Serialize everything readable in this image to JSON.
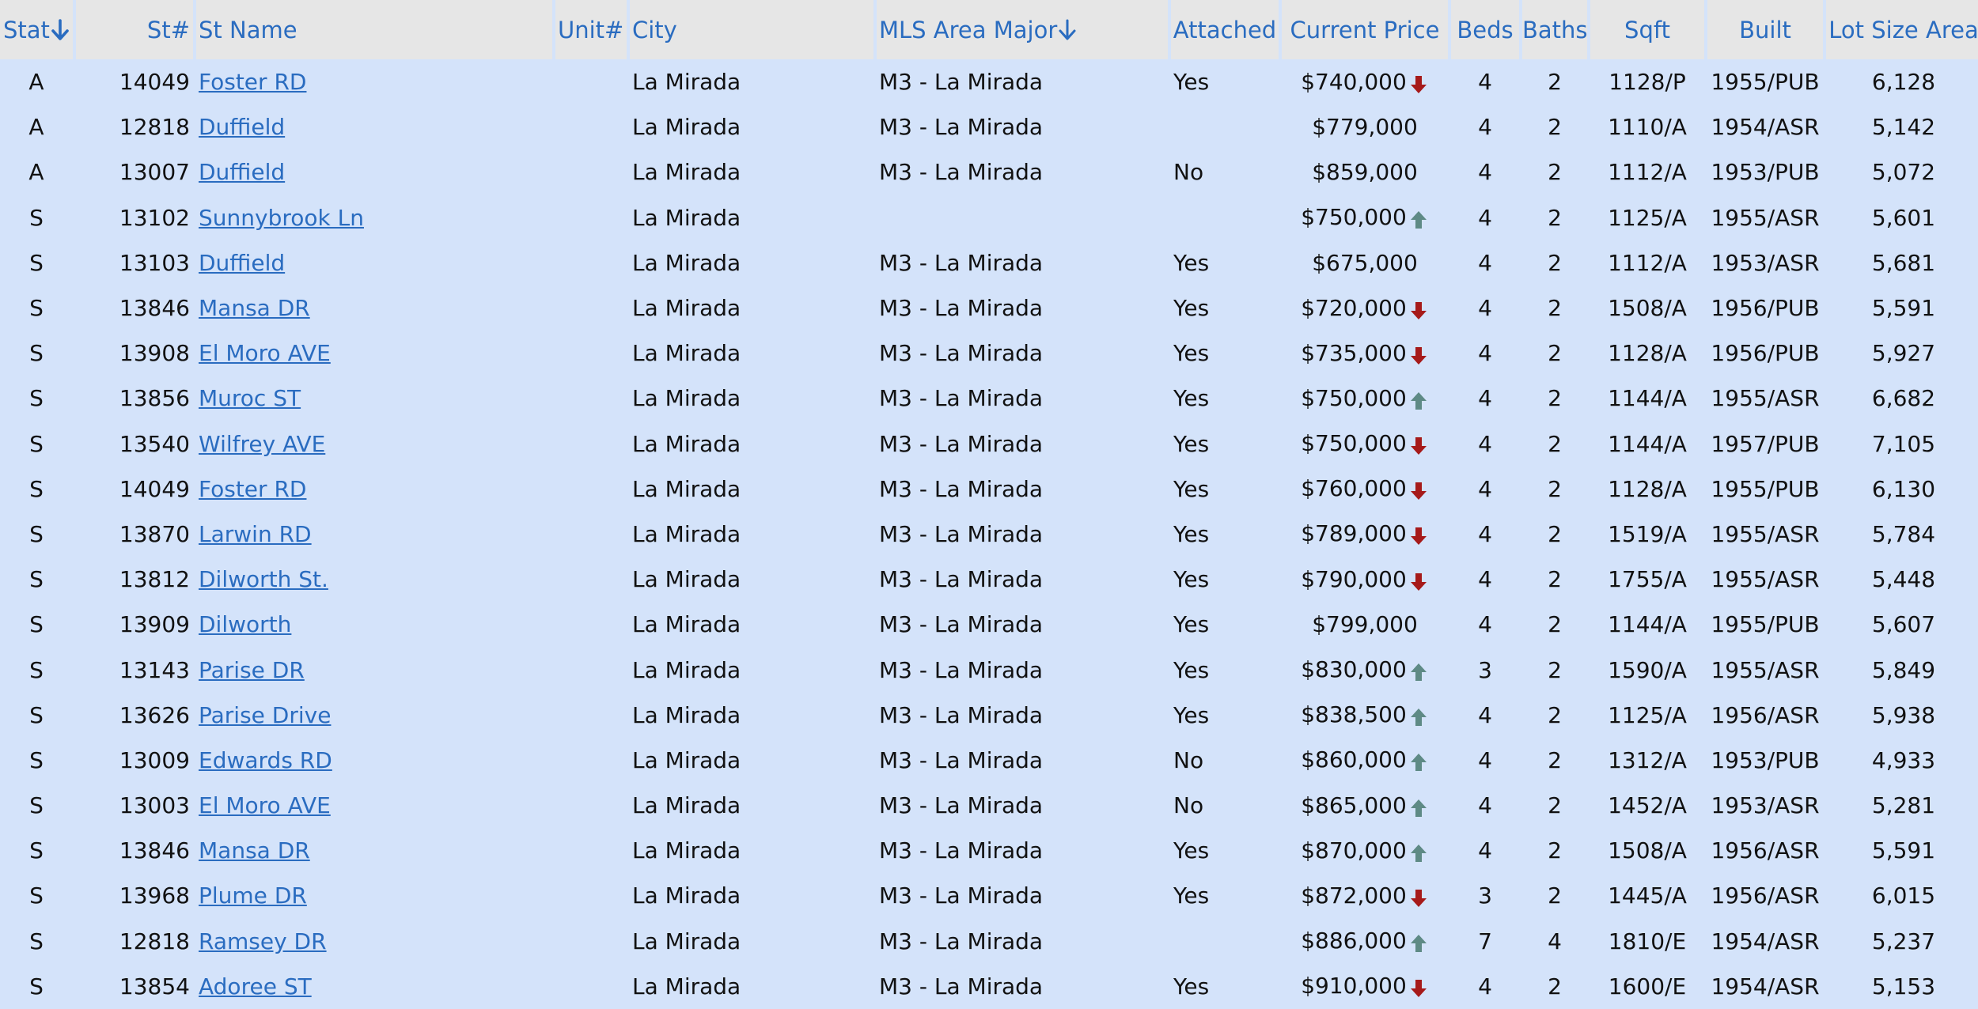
{
  "colors": {
    "header_bg": "#e6e6e6",
    "header_text": "#2a6cc0",
    "row_bg": "#d4e3fa",
    "link": "#2a6cc0",
    "trend_down": "#a61a1a",
    "trend_up": "#5e8a85"
  },
  "headers": {
    "stat": "Stat",
    "st_num": "St#",
    "st_name": "St Name",
    "unit": "Unit#",
    "city": "City",
    "mls_area": "MLS Area Major",
    "attached": "Attached",
    "current_price": "Current Price",
    "beds": "Beds",
    "baths": "Baths",
    "sqft": "Sqft",
    "built": "Built",
    "lot": "Lot Size Area"
  },
  "sort_icons": {
    "stat": "sort-down-arrow-icon",
    "mls_area": "sort-down-arrow-icon"
  },
  "rows": [
    {
      "stat": "A",
      "num": "14049",
      "name": "Foster RD",
      "unit": "",
      "city": "La Mirada",
      "area": "M3 - La Mirada",
      "attached": "Yes",
      "price": "$740,000",
      "trend": "down",
      "beds": "4",
      "baths": "2",
      "sqft": "1128/P",
      "built": "1955/PUB",
      "lot": "6,128"
    },
    {
      "stat": "A",
      "num": "12818",
      "name": "Duffield",
      "unit": "",
      "city": "La Mirada",
      "area": "M3 - La Mirada",
      "attached": "",
      "price": "$779,000",
      "trend": "",
      "beds": "4",
      "baths": "2",
      "sqft": "1110/A",
      "built": "1954/ASR",
      "lot": "5,142"
    },
    {
      "stat": "A",
      "num": "13007",
      "name": "Duffield",
      "unit": "",
      "city": "La Mirada",
      "area": "M3 - La Mirada",
      "attached": "No",
      "price": "$859,000",
      "trend": "",
      "beds": "4",
      "baths": "2",
      "sqft": "1112/A",
      "built": "1953/PUB",
      "lot": "5,072"
    },
    {
      "stat": "S",
      "num": "13102",
      "name": "Sunnybrook Ln",
      "unit": "",
      "city": "La Mirada",
      "area": "",
      "attached": "",
      "price": "$750,000",
      "trend": "up",
      "beds": "4",
      "baths": "2",
      "sqft": "1125/A",
      "built": "1955/ASR",
      "lot": "5,601"
    },
    {
      "stat": "S",
      "num": "13103",
      "name": "Duffield",
      "unit": "",
      "city": "La Mirada",
      "area": "M3 - La Mirada",
      "attached": "Yes",
      "price": "$675,000",
      "trend": "",
      "beds": "4",
      "baths": "2",
      "sqft": "1112/A",
      "built": "1953/ASR",
      "lot": "5,681"
    },
    {
      "stat": "S",
      "num": "13846",
      "name": "Mansa DR",
      "unit": "",
      "city": "La Mirada",
      "area": "M3 - La Mirada",
      "attached": "Yes",
      "price": "$720,000",
      "trend": "down",
      "beds": "4",
      "baths": "2",
      "sqft": "1508/A",
      "built": "1956/PUB",
      "lot": "5,591"
    },
    {
      "stat": "S",
      "num": "13908",
      "name": "El Moro AVE",
      "unit": "",
      "city": "La Mirada",
      "area": "M3 - La Mirada",
      "attached": "Yes",
      "price": "$735,000",
      "trend": "down",
      "beds": "4",
      "baths": "2",
      "sqft": "1128/A",
      "built": "1956/PUB",
      "lot": "5,927"
    },
    {
      "stat": "S",
      "num": "13856",
      "name": "Muroc ST",
      "unit": "",
      "city": "La Mirada",
      "area": "M3 - La Mirada",
      "attached": "Yes",
      "price": "$750,000",
      "trend": "up",
      "beds": "4",
      "baths": "2",
      "sqft": "1144/A",
      "built": "1955/ASR",
      "lot": "6,682"
    },
    {
      "stat": "S",
      "num": "13540",
      "name": "Wilfrey AVE",
      "unit": "",
      "city": "La Mirada",
      "area": "M3 - La Mirada",
      "attached": "Yes",
      "price": "$750,000",
      "trend": "down",
      "beds": "4",
      "baths": "2",
      "sqft": "1144/A",
      "built": "1957/PUB",
      "lot": "7,105"
    },
    {
      "stat": "S",
      "num": "14049",
      "name": "Foster RD",
      "unit": "",
      "city": "La Mirada",
      "area": "M3 - La Mirada",
      "attached": "Yes",
      "price": "$760,000",
      "trend": "down",
      "beds": "4",
      "baths": "2",
      "sqft": "1128/A",
      "built": "1955/PUB",
      "lot": "6,130"
    },
    {
      "stat": "S",
      "num": "13870",
      "name": "Larwin RD",
      "unit": "",
      "city": "La Mirada",
      "area": "M3 - La Mirada",
      "attached": "Yes",
      "price": "$789,000",
      "trend": "down",
      "beds": "4",
      "baths": "2",
      "sqft": "1519/A",
      "built": "1955/ASR",
      "lot": "5,784"
    },
    {
      "stat": "S",
      "num": "13812",
      "name": "Dilworth St.",
      "unit": "",
      "city": "La Mirada",
      "area": "M3 - La Mirada",
      "attached": "Yes",
      "price": "$790,000",
      "trend": "down",
      "beds": "4",
      "baths": "2",
      "sqft": "1755/A",
      "built": "1955/ASR",
      "lot": "5,448"
    },
    {
      "stat": "S",
      "num": "13909",
      "name": "Dilworth",
      "unit": "",
      "city": "La Mirada",
      "area": "M3 - La Mirada",
      "attached": "Yes",
      "price": "$799,000",
      "trend": "",
      "beds": "4",
      "baths": "2",
      "sqft": "1144/A",
      "built": "1955/PUB",
      "lot": "5,607"
    },
    {
      "stat": "S",
      "num": "13143",
      "name": "Parise DR",
      "unit": "",
      "city": "La Mirada",
      "area": "M3 - La Mirada",
      "attached": "Yes",
      "price": "$830,000",
      "trend": "up",
      "beds": "3",
      "baths": "2",
      "sqft": "1590/A",
      "built": "1955/ASR",
      "lot": "5,849"
    },
    {
      "stat": "S",
      "num": "13626",
      "name": "Parise Drive",
      "unit": "",
      "city": "La Mirada",
      "area": "M3 - La Mirada",
      "attached": "Yes",
      "price": "$838,500",
      "trend": "up",
      "beds": "4",
      "baths": "2",
      "sqft": "1125/A",
      "built": "1956/ASR",
      "lot": "5,938"
    },
    {
      "stat": "S",
      "num": "13009",
      "name": "Edwards RD",
      "unit": "",
      "city": "La Mirada",
      "area": "M3 - La Mirada",
      "attached": "No",
      "price": "$860,000",
      "trend": "up",
      "beds": "4",
      "baths": "2",
      "sqft": "1312/A",
      "built": "1953/PUB",
      "lot": "4,933"
    },
    {
      "stat": "S",
      "num": "13003",
      "name": "El Moro AVE",
      "unit": "",
      "city": "La Mirada",
      "area": "M3 - La Mirada",
      "attached": "No",
      "price": "$865,000",
      "trend": "up",
      "beds": "4",
      "baths": "2",
      "sqft": "1452/A",
      "built": "1953/ASR",
      "lot": "5,281"
    },
    {
      "stat": "S",
      "num": "13846",
      "name": "Mansa DR",
      "unit": "",
      "city": "La Mirada",
      "area": "M3 - La Mirada",
      "attached": "Yes",
      "price": "$870,000",
      "trend": "up",
      "beds": "4",
      "baths": "2",
      "sqft": "1508/A",
      "built": "1956/ASR",
      "lot": "5,591"
    },
    {
      "stat": "S",
      "num": "13968",
      "name": "Plume DR",
      "unit": "",
      "city": "La Mirada",
      "area": "M3 - La Mirada",
      "attached": "Yes",
      "price": "$872,000",
      "trend": "down",
      "beds": "3",
      "baths": "2",
      "sqft": "1445/A",
      "built": "1956/ASR",
      "lot": "6,015"
    },
    {
      "stat": "S",
      "num": "12818",
      "name": "Ramsey DR",
      "unit": "",
      "city": "La Mirada",
      "area": "M3 - La Mirada",
      "attached": "",
      "price": "$886,000",
      "trend": "up",
      "beds": "7",
      "baths": "4",
      "sqft": "1810/E",
      "built": "1954/ASR",
      "lot": "5,237"
    },
    {
      "stat": "S",
      "num": "13854",
      "name": "Adoree ST",
      "unit": "",
      "city": "La Mirada",
      "area": "M3 - La Mirada",
      "attached": "Yes",
      "price": "$910,000",
      "trend": "down",
      "beds": "4",
      "baths": "2",
      "sqft": "1600/E",
      "built": "1954/ASR",
      "lot": "5,153"
    }
  ]
}
